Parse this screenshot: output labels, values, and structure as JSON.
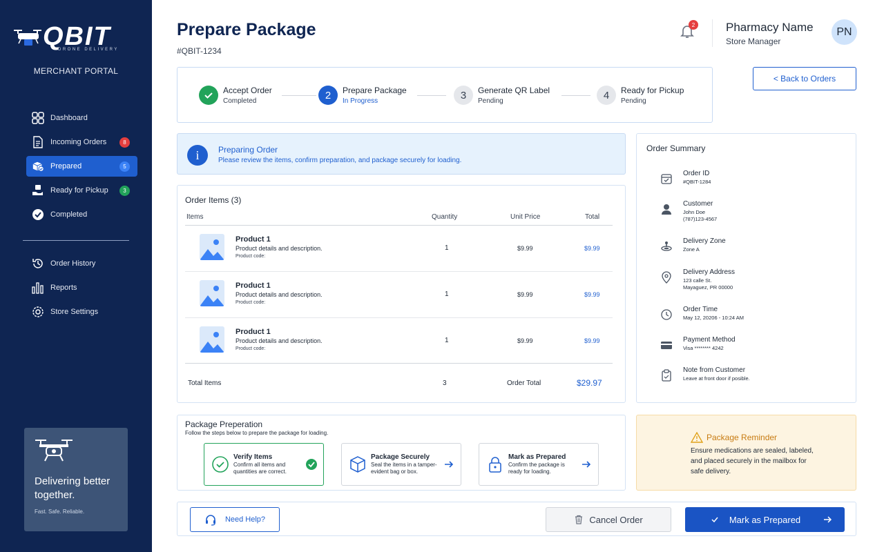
{
  "brand": {
    "logo_text": "QBIT",
    "logo_sub": "DRONE DELIVERY",
    "portal_label": "MERCHANT PORTAL",
    "color_navy": "#0f2552",
    "color_accent": "#1f5fcf"
  },
  "sidebar": {
    "items": [
      {
        "label": "Dashboard",
        "icon": "grid-icon"
      },
      {
        "label": "Incoming Orders",
        "icon": "document-icon",
        "badge": "8",
        "badge_color": "#e53e3e"
      },
      {
        "label": "Prepared",
        "icon": "package-check-icon",
        "badge": "5",
        "badge_color": "#3b82f6",
        "active": true
      },
      {
        "label": "Ready for Pickup",
        "icon": "hand-box-icon",
        "badge": "3",
        "badge_color": "#22a35a"
      },
      {
        "label": "Completed",
        "icon": "check-circle-icon"
      }
    ],
    "secondary": [
      {
        "label": "Order History",
        "icon": "history-icon"
      },
      {
        "label": "Reports",
        "icon": "bar-chart-icon"
      },
      {
        "label": "Store Settings",
        "icon": "gear-icon"
      }
    ],
    "promo": {
      "title": "Delivering better together.",
      "subtitle": "Fast. Safe. Reliable.",
      "icon": "drone-icon"
    }
  },
  "header": {
    "title": "Prepare Package",
    "order_id": "#QBIT-1234",
    "notification_count": "2",
    "user_name": "Pharmacy Name",
    "user_role": "Store Manager",
    "avatar_initials": "PN"
  },
  "stepper": {
    "steps": [
      {
        "number": "",
        "title": "Accept Order",
        "status": "Completed",
        "state": "completed"
      },
      {
        "number": "2",
        "title": "Prepare Package",
        "status": "In Progress",
        "state": "active"
      },
      {
        "number": "3",
        "title": "Generate QR Label",
        "status": "Pending",
        "state": "pending"
      },
      {
        "number": "4",
        "title": "Ready for Pickup",
        "status": "Pending",
        "state": "pending"
      }
    ]
  },
  "back_button": "< Back to Orders",
  "info_banner": {
    "title": "Preparing Order",
    "text": "Please review the items, confirm preparation, and package securely for loading."
  },
  "order_items": {
    "title": "Order Items (3)",
    "columns": [
      "Items",
      "Quantity",
      "Unit Price",
      "Total"
    ],
    "rows": [
      {
        "name": "Product 1",
        "description": "Product details and description.",
        "code": "Product code:",
        "quantity": "1",
        "unit_price": "$9.99",
        "total": "$9.99"
      },
      {
        "name": "Product 1",
        "description": "Product details and description.",
        "code": "Product code:",
        "quantity": "1",
        "unit_price": "$9.99",
        "total": "$9.99"
      },
      {
        "name": "Product 1",
        "description": "Product details and description.",
        "code": "Product code:",
        "quantity": "1",
        "unit_price": "$9.99",
        "total": "$9.99"
      }
    ],
    "total_items_label": "Total Items",
    "total_items": "3",
    "order_total_label": "Order Total",
    "order_total": "$29.97"
  },
  "summary": {
    "title": "Order Summary",
    "rows": [
      {
        "label": "Order ID",
        "value": "#QBIT-1284",
        "icon": "calendar-check-icon"
      },
      {
        "label": "Customer",
        "value": "John Doe",
        "value2": "(787)123-4567",
        "icon": "person-icon"
      },
      {
        "label": "Delivery Zone",
        "value": "Zone A",
        "icon": "zone-pin-icon"
      },
      {
        "label": "Delivery Address",
        "value": "123 calle St.",
        "value2": "Mayaguez, PR 00000",
        "icon": "location-pin-icon"
      },
      {
        "label": "Order Time",
        "value": "May 12, 20206 - 10:24 AM",
        "icon": "clock-icon"
      },
      {
        "label": "Payment Method",
        "value": "Visa ******** 4242",
        "icon": "credit-card-icon"
      },
      {
        "label": "Note from Customer",
        "value": "Leave at front door if posible.",
        "icon": "clipboard-icon"
      }
    ]
  },
  "prep": {
    "title": "Package Preperation",
    "subtitle": "Follow the steps below to prepare the package for loading.",
    "steps": [
      {
        "title": "Verify Items",
        "text": "Confirm all items and quantities are correct.",
        "icon": "check-circle-outline-icon",
        "done": true
      },
      {
        "title": "Package Securely",
        "text": "Seal the items in a tamper-evident bag or box.",
        "icon": "box-icon",
        "done": false
      },
      {
        "title": "Mark as Prepared",
        "text": "Confirm the package is ready for loading.",
        "icon": "lock-icon",
        "done": false
      }
    ]
  },
  "reminder": {
    "title": "Package Reminder",
    "text": "Ensure medications are sealed, labeled, and placed securely in the mailbox for safe delivery.",
    "icon": "warning-icon"
  },
  "actions": {
    "help": "Need Help?",
    "cancel": "Cancel Order",
    "mark": "Mark as Prepared"
  }
}
